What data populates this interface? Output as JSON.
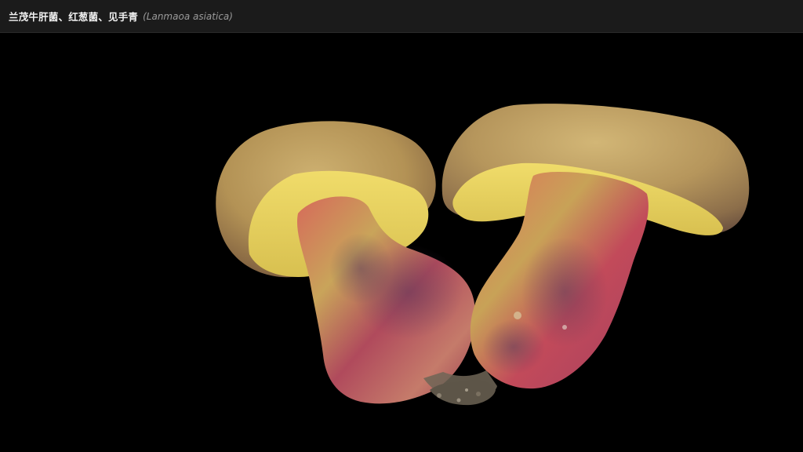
{
  "header": {
    "title_cn": "兰茂牛肝菌、红葱菌、见手青",
    "title_latin": "(Lanmaoa asiatica)"
  },
  "colors": {
    "header_bg": "#1b1b1b",
    "canvas_bg": "#000000",
    "cap": "#b89a5a",
    "pores": "#e8d460",
    "stem_red": "#c2414d",
    "stem_yellow": "#d8b250"
  },
  "image": {
    "subject": "two-mushrooms-photo"
  }
}
